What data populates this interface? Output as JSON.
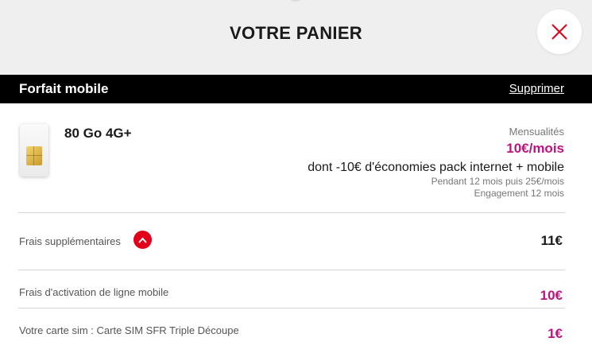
{
  "header": {
    "title": "VOTRE PANIER"
  },
  "section": {
    "title": "Forfait mobile",
    "remove_label": "Supprimer"
  },
  "product": {
    "name": "80 Go 4G+",
    "price_label": "Mensualités",
    "price": "10€/mois",
    "discount": "dont -10€ d'économies pack internet + mobile",
    "period_note": "Pendant 12 mois puis 25€/mois",
    "commitment": "Engagement 12 mois"
  },
  "fees": [
    {
      "label": "Frais supplémentaires",
      "amount": "11€",
      "color": "#1a1a1a"
    },
    {
      "label": "Frais d'activation de ligne mobile",
      "amount": "10€",
      "color": "#c0127e"
    },
    {
      "label": "Votre carte sim : Carte SIM SFR Triple Découpe",
      "amount": "1€",
      "color": "#c0127e"
    }
  ],
  "colors": {
    "accent": "#e2001a",
    "price": "#c0127e",
    "bar": "#000000",
    "header_bg": "#efefef"
  },
  "icons": {
    "close": "close-icon",
    "toggle": "chevron-up-icon",
    "sim": "sim-card-icon"
  }
}
